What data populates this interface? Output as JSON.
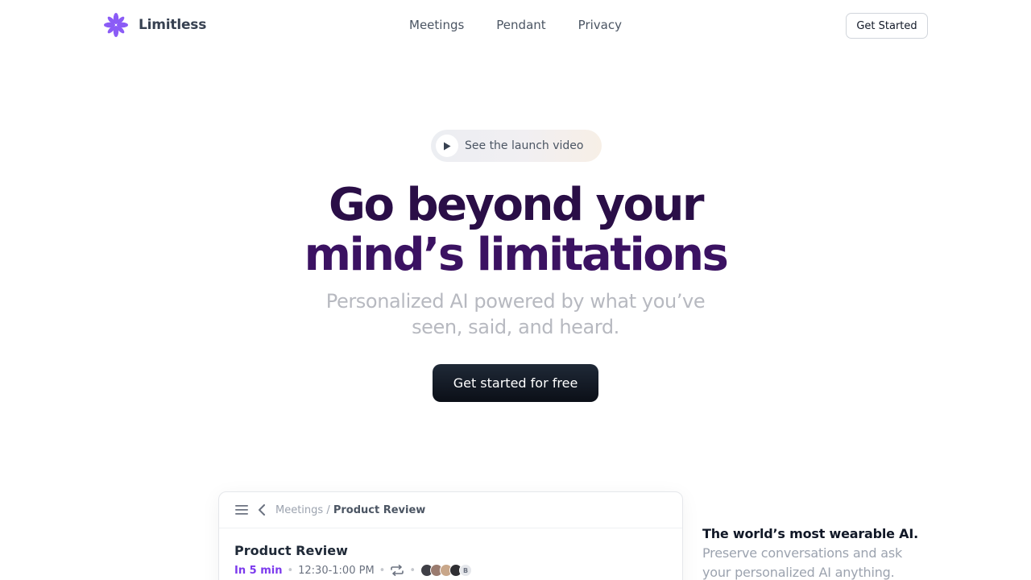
{
  "header": {
    "brand_name": "Limitless",
    "brand_color": "#8b5cf6",
    "nav": [
      "Meetings",
      "Pendant",
      "Privacy"
    ],
    "cta_label": "Get Started"
  },
  "hero": {
    "video_pill_label": "See the launch video",
    "headline_line1": "Go beyond your",
    "headline_line2": "mind’s limitations",
    "subhead": "Personalized AI powered by what you’ve seen, said, and heard.",
    "cta_label": "Get started for free"
  },
  "preview": {
    "breadcrumb_parent": "Meetings",
    "breadcrumb_separator": " / ",
    "breadcrumb_current": "Product Review",
    "title": "Product Review",
    "starts_in": "In 5 min",
    "time_range": "12:30-1:00 PM",
    "extra_attendee_initial": "B",
    "accent_color": "#7c3aed"
  },
  "side": {
    "title": "The world’s most wearable AI.",
    "text": "Preserve conversations and ask your personalized AI anything."
  }
}
